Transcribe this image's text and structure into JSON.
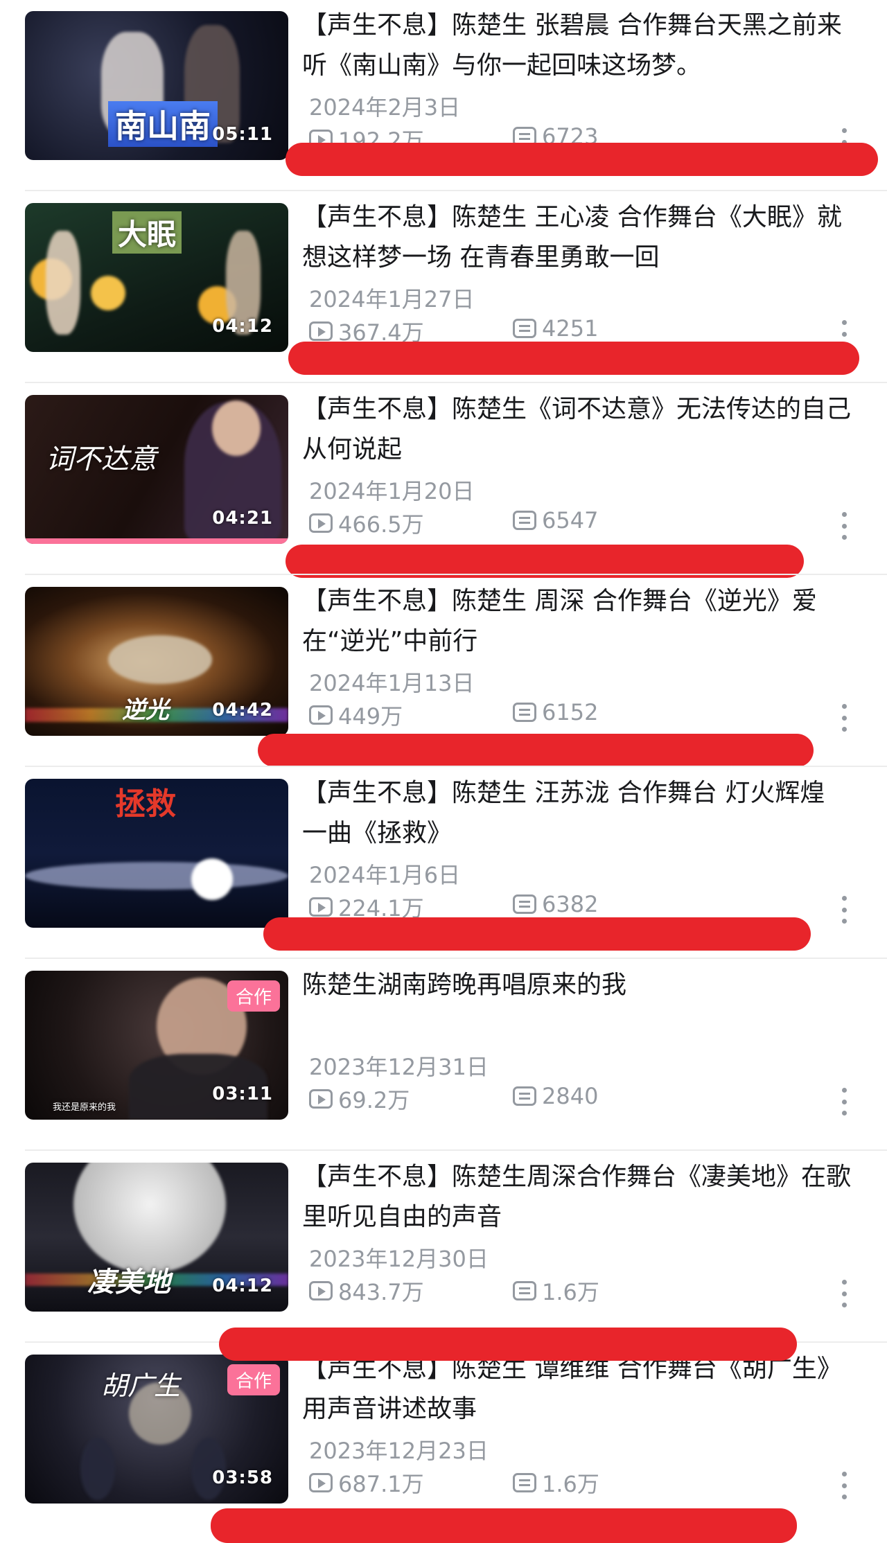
{
  "videos": [
    {
      "title": "【声生不息】陈楚生 张碧晨 合作舞台天黑之前来听《南山南》与你一起回味这场梦。",
      "date": "2024年2月3日",
      "views": "192.2万",
      "danmu": "6723",
      "duration": "05:11",
      "overlay": "南山南",
      "badge": ""
    },
    {
      "title": "【声生不息】陈楚生 王心凌 合作舞台《大眠》就想这样梦一场 在青春里勇敢一回",
      "date": "2024年1月27日",
      "views": "367.4万",
      "danmu": "4251",
      "duration": "04:12",
      "overlay": "大眠",
      "badge": ""
    },
    {
      "title": "【声生不息】陈楚生《词不达意》无法传达的自己 从何说起",
      "date": "2024年1月20日",
      "views": "466.5万",
      "danmu": "6547",
      "duration": "04:21",
      "overlay": "词不达意",
      "badge": ""
    },
    {
      "title": "【声生不息】陈楚生 周深 合作舞台《逆光》爱在“逆光”中前行",
      "date": "2024年1月13日",
      "views": "449万",
      "danmu": "6152",
      "duration": "04:42",
      "overlay": "逆光",
      "badge": ""
    },
    {
      "title": "【声生不息】陈楚生 汪苏泷 合作舞台 灯火辉煌 一曲《拯救》",
      "date": "2024年1月6日",
      "views": "224.1万",
      "danmu": "6382",
      "duration": "",
      "overlay": "拯救",
      "badge": ""
    },
    {
      "title": "陈楚生湖南跨晚再唱原来的我",
      "date": "2023年12月31日",
      "views": "69.2万",
      "danmu": "2840",
      "duration": "03:11",
      "overlay": "我还是原来的我",
      "badge": "合作"
    },
    {
      "title": "【声生不息】陈楚生周深合作舞台《凄美地》在歌里听见自由的声音",
      "date": "2023年12月30日",
      "views": "843.7万",
      "danmu": "1.6万",
      "duration": "04:12",
      "overlay": "凄美地",
      "badge": ""
    },
    {
      "title": "【声生不息】陈楚生 谭维维 合作舞台《胡广生》用声音讲述故事",
      "date": "2023年12月23日",
      "views": "687.1万",
      "danmu": "1.6万",
      "duration": "03:58",
      "overlay": "胡广生",
      "badge": "合作"
    }
  ]
}
